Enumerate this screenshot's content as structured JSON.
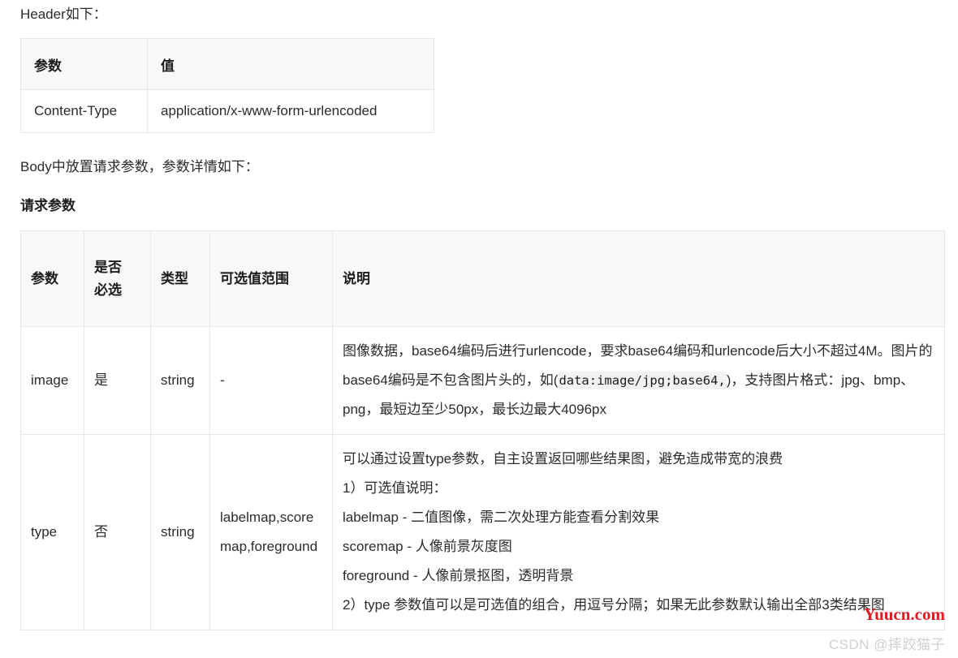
{
  "document": {
    "header_intro": "Header如下：",
    "body_intro": "Body中放置请求参数，参数详情如下：",
    "section_heading": "请求参数"
  },
  "header_table": {
    "columns": [
      "参数",
      "值"
    ],
    "rows": [
      {
        "param": "Content-Type",
        "value": "application/x-www-form-urlencoded"
      }
    ]
  },
  "params_table": {
    "columns": [
      "参数",
      "是否\n必选",
      "类型",
      "可选值范围",
      "说明"
    ],
    "column_labels": {
      "param": "参数",
      "required_line1": "是否",
      "required_line2": "必选",
      "type": "类型",
      "range": "可选值范围",
      "description": "说明"
    },
    "rows": [
      {
        "param": "image",
        "required": "是",
        "type": "string",
        "range": "-",
        "description_parts": {
          "before_code": "图像数据，base64编码后进行urlencode，要求base64编码和urlencode后大小不超过4M。图片的base64编码是不包含图片头的，如(",
          "code": "data:image/jpg;base64,",
          "after_code": ")，支持图片格式：jpg、bmp、png，最短边至少50px，最长边最大4096px"
        }
      },
      {
        "param": "type",
        "required": "否",
        "type": "string",
        "range": "labelmap,scoremap,foreground",
        "description_lines": [
          "可以通过设置type参数，自主设置返回哪些结果图，避免造成带宽的浪费",
          "1）可选值说明：",
          "labelmap - 二值图像，需二次处理方能查看分割效果",
          "scoremap - 人像前景灰度图",
          "foreground - 人像前景抠图，透明背景",
          "2）type 参数值可以是可选值的组合，用逗号分隔；如果无此参数默认输出全部3类结果图"
        ]
      }
    ]
  },
  "watermarks": {
    "yuucn": "Yuucn.com",
    "csdn": "CSDN @摔跤猫子"
  },
  "colors": {
    "yuucn_red": "#e01b24",
    "csdn_gray": "#cfcfcf",
    "table_border": "#e8e8e8",
    "table_header_bg": "#f8f8f8",
    "inline_code_bg": "#f2f2f2",
    "text": "#2b2b2b"
  }
}
